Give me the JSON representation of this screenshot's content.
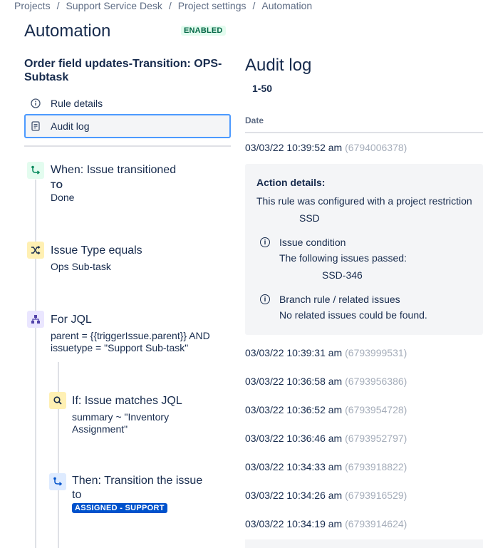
{
  "breadcrumb": [
    "Projects",
    "Support Service Desk",
    "Project settings",
    "Automation"
  ],
  "page_title": "Automation",
  "status_badge": "ENABLED",
  "rule_name": "Order field updates-Transition: OPS-Subtask",
  "nav": {
    "rule_details": "Rule details",
    "audit_log": "Audit log"
  },
  "flow": {
    "trigger": {
      "title": "When: Issue transitioned",
      "to_label": "TO",
      "to_value": "Done"
    },
    "condition": {
      "title": "Issue Type equals",
      "value": "Ops Sub-task"
    },
    "branch": {
      "title": "For JQL",
      "value": "parent = {{triggerIssue.parent}} AND issuetype = \"Support Sub-task\""
    },
    "if_cond": {
      "title": "If: Issue matches JQL",
      "value": "summary ~ \"Inventory Assignment\""
    },
    "action": {
      "title": "Then: Transition the issue to",
      "status": "ASSIGNED - SUPPORT"
    }
  },
  "audit": {
    "title": "Audit log",
    "range": "1-50",
    "col_date": "Date",
    "first_row": {
      "date": "03/03/22 10:39:52 am",
      "id": "(6794006378)"
    },
    "details": {
      "heading": "Action details:",
      "restriction_text": "This rule was configured with a project restriction",
      "restriction_value": "SSD",
      "issue_condition_title": "Issue condition",
      "issue_condition_text": "The following issues passed:",
      "issue_condition_value": "SSD-346",
      "branch_title": "Branch rule / related issues",
      "branch_text": "No related issues could be found."
    },
    "rows": [
      {
        "date": "03/03/22 10:39:31 am",
        "id": "(6793999531)"
      },
      {
        "date": "03/03/22 10:36:58 am",
        "id": "(6793956386)"
      },
      {
        "date": "03/03/22 10:36:52 am",
        "id": "(6793954728)"
      },
      {
        "date": "03/03/22 10:36:46 am",
        "id": "(6793952797)"
      },
      {
        "date": "03/03/22 10:34:33 am",
        "id": "(6793918822)"
      },
      {
        "date": "03/03/22 10:34:26 am",
        "id": "(6793916529)"
      },
      {
        "date": "03/03/22 10:34:19 am",
        "id": "(6793914624)"
      }
    ]
  },
  "icons": {
    "info": "info-icon",
    "document": "document-icon",
    "trigger": "transition-icon",
    "condition": "shuffle-icon",
    "branch": "hierarchy-icon",
    "if": "search-icon",
    "action": "transition-icon"
  },
  "colors": {
    "accent": "#0052cc",
    "enabled_bg": "#e3fcef",
    "enabled_text": "#006644",
    "trigger_bg": "#e3fcef",
    "condition_bg": "#fff0b3",
    "branch_bg": "#eae6ff",
    "action_bg": "#deebff"
  }
}
